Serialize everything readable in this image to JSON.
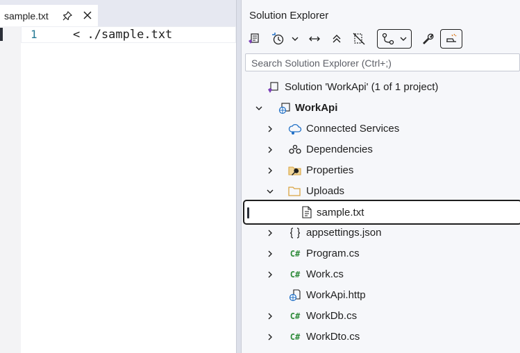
{
  "editor": {
    "tab": {
      "title": "sample.txt"
    },
    "lines": [
      {
        "number": "1",
        "text": "< ./sample.txt"
      }
    ]
  },
  "explorer": {
    "title": "Solution Explorer",
    "search": {
      "placeholder": "Search Solution Explorer (Ctrl+;)",
      "value": ""
    },
    "toolbar": [
      "solution-view-icon",
      "history-icon",
      "sync-icon",
      "collapse-all-icon",
      "show-all-files-icon",
      "pending-changes-filter-icon",
      "properties-icon",
      "preview-icon"
    ],
    "tree": [
      {
        "label": "Solution 'WorkApi' (1 of 1 project)",
        "icon": "solution-icon"
      },
      {
        "label": "WorkApi",
        "icon": "web-project-icon",
        "expanded": true
      },
      {
        "label": "Connected Services",
        "icon": "connected-services-icon"
      },
      {
        "label": "Dependencies",
        "icon": "dependencies-icon"
      },
      {
        "label": "Properties",
        "icon": "properties-folder-icon"
      },
      {
        "label": "Uploads",
        "icon": "folder-icon",
        "expanded": true
      },
      {
        "label": "sample.txt",
        "icon": "text-file-icon",
        "selected": true
      },
      {
        "label": "appsettings.json",
        "icon": "json-file-icon"
      },
      {
        "label": "Program.cs",
        "icon": "csharp-file-icon",
        "badge": "C#"
      },
      {
        "label": "Work.cs",
        "icon": "csharp-file-icon",
        "badge": "C#"
      },
      {
        "label": "WorkApi.http",
        "icon": "http-file-icon"
      },
      {
        "label": "WorkDb.cs",
        "icon": "csharp-file-icon",
        "badge": "C#"
      },
      {
        "label": "WorkDto.cs",
        "icon": "csharp-file-icon",
        "badge": "C#"
      }
    ]
  },
  "colors": {
    "csharp": "#2f8b3a",
    "folder": "#d9a441",
    "accent_purple": "#7b3fb8",
    "accent_blue": "#1f6fc6"
  }
}
